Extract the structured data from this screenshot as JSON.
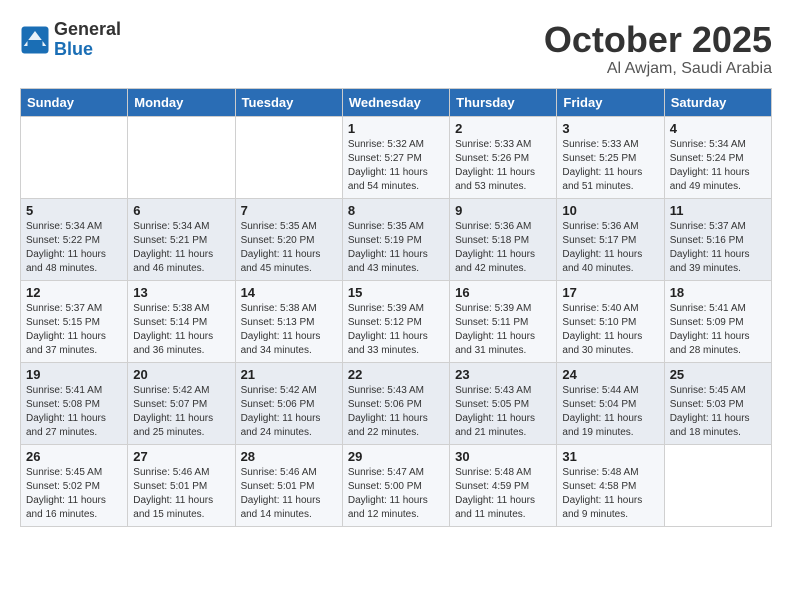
{
  "logo": {
    "general": "General",
    "blue": "Blue"
  },
  "header": {
    "month": "October 2025",
    "location": "Al Awjam, Saudi Arabia"
  },
  "weekdays": [
    "Sunday",
    "Monday",
    "Tuesday",
    "Wednesday",
    "Thursday",
    "Friday",
    "Saturday"
  ],
  "weeks": [
    [
      {
        "day": "",
        "info": ""
      },
      {
        "day": "",
        "info": ""
      },
      {
        "day": "",
        "info": ""
      },
      {
        "day": "1",
        "info": "Sunrise: 5:32 AM\nSunset: 5:27 PM\nDaylight: 11 hours\nand 54 minutes."
      },
      {
        "day": "2",
        "info": "Sunrise: 5:33 AM\nSunset: 5:26 PM\nDaylight: 11 hours\nand 53 minutes."
      },
      {
        "day": "3",
        "info": "Sunrise: 5:33 AM\nSunset: 5:25 PM\nDaylight: 11 hours\nand 51 minutes."
      },
      {
        "day": "4",
        "info": "Sunrise: 5:34 AM\nSunset: 5:24 PM\nDaylight: 11 hours\nand 49 minutes."
      }
    ],
    [
      {
        "day": "5",
        "info": "Sunrise: 5:34 AM\nSunset: 5:22 PM\nDaylight: 11 hours\nand 48 minutes."
      },
      {
        "day": "6",
        "info": "Sunrise: 5:34 AM\nSunset: 5:21 PM\nDaylight: 11 hours\nand 46 minutes."
      },
      {
        "day": "7",
        "info": "Sunrise: 5:35 AM\nSunset: 5:20 PM\nDaylight: 11 hours\nand 45 minutes."
      },
      {
        "day": "8",
        "info": "Sunrise: 5:35 AM\nSunset: 5:19 PM\nDaylight: 11 hours\nand 43 minutes."
      },
      {
        "day": "9",
        "info": "Sunrise: 5:36 AM\nSunset: 5:18 PM\nDaylight: 11 hours\nand 42 minutes."
      },
      {
        "day": "10",
        "info": "Sunrise: 5:36 AM\nSunset: 5:17 PM\nDaylight: 11 hours\nand 40 minutes."
      },
      {
        "day": "11",
        "info": "Sunrise: 5:37 AM\nSunset: 5:16 PM\nDaylight: 11 hours\nand 39 minutes."
      }
    ],
    [
      {
        "day": "12",
        "info": "Sunrise: 5:37 AM\nSunset: 5:15 PM\nDaylight: 11 hours\nand 37 minutes."
      },
      {
        "day": "13",
        "info": "Sunrise: 5:38 AM\nSunset: 5:14 PM\nDaylight: 11 hours\nand 36 minutes."
      },
      {
        "day": "14",
        "info": "Sunrise: 5:38 AM\nSunset: 5:13 PM\nDaylight: 11 hours\nand 34 minutes."
      },
      {
        "day": "15",
        "info": "Sunrise: 5:39 AM\nSunset: 5:12 PM\nDaylight: 11 hours\nand 33 minutes."
      },
      {
        "day": "16",
        "info": "Sunrise: 5:39 AM\nSunset: 5:11 PM\nDaylight: 11 hours\nand 31 minutes."
      },
      {
        "day": "17",
        "info": "Sunrise: 5:40 AM\nSunset: 5:10 PM\nDaylight: 11 hours\nand 30 minutes."
      },
      {
        "day": "18",
        "info": "Sunrise: 5:41 AM\nSunset: 5:09 PM\nDaylight: 11 hours\nand 28 minutes."
      }
    ],
    [
      {
        "day": "19",
        "info": "Sunrise: 5:41 AM\nSunset: 5:08 PM\nDaylight: 11 hours\nand 27 minutes."
      },
      {
        "day": "20",
        "info": "Sunrise: 5:42 AM\nSunset: 5:07 PM\nDaylight: 11 hours\nand 25 minutes."
      },
      {
        "day": "21",
        "info": "Sunrise: 5:42 AM\nSunset: 5:06 PM\nDaylight: 11 hours\nand 24 minutes."
      },
      {
        "day": "22",
        "info": "Sunrise: 5:43 AM\nSunset: 5:06 PM\nDaylight: 11 hours\nand 22 minutes."
      },
      {
        "day": "23",
        "info": "Sunrise: 5:43 AM\nSunset: 5:05 PM\nDaylight: 11 hours\nand 21 minutes."
      },
      {
        "day": "24",
        "info": "Sunrise: 5:44 AM\nSunset: 5:04 PM\nDaylight: 11 hours\nand 19 minutes."
      },
      {
        "day": "25",
        "info": "Sunrise: 5:45 AM\nSunset: 5:03 PM\nDaylight: 11 hours\nand 18 minutes."
      }
    ],
    [
      {
        "day": "26",
        "info": "Sunrise: 5:45 AM\nSunset: 5:02 PM\nDaylight: 11 hours\nand 16 minutes."
      },
      {
        "day": "27",
        "info": "Sunrise: 5:46 AM\nSunset: 5:01 PM\nDaylight: 11 hours\nand 15 minutes."
      },
      {
        "day": "28",
        "info": "Sunrise: 5:46 AM\nSunset: 5:01 PM\nDaylight: 11 hours\nand 14 minutes."
      },
      {
        "day": "29",
        "info": "Sunrise: 5:47 AM\nSunset: 5:00 PM\nDaylight: 11 hours\nand 12 minutes."
      },
      {
        "day": "30",
        "info": "Sunrise: 5:48 AM\nSunset: 4:59 PM\nDaylight: 11 hours\nand 11 minutes."
      },
      {
        "day": "31",
        "info": "Sunrise: 5:48 AM\nSunset: 4:58 PM\nDaylight: 11 hours\nand 9 minutes."
      },
      {
        "day": "",
        "info": ""
      }
    ]
  ]
}
